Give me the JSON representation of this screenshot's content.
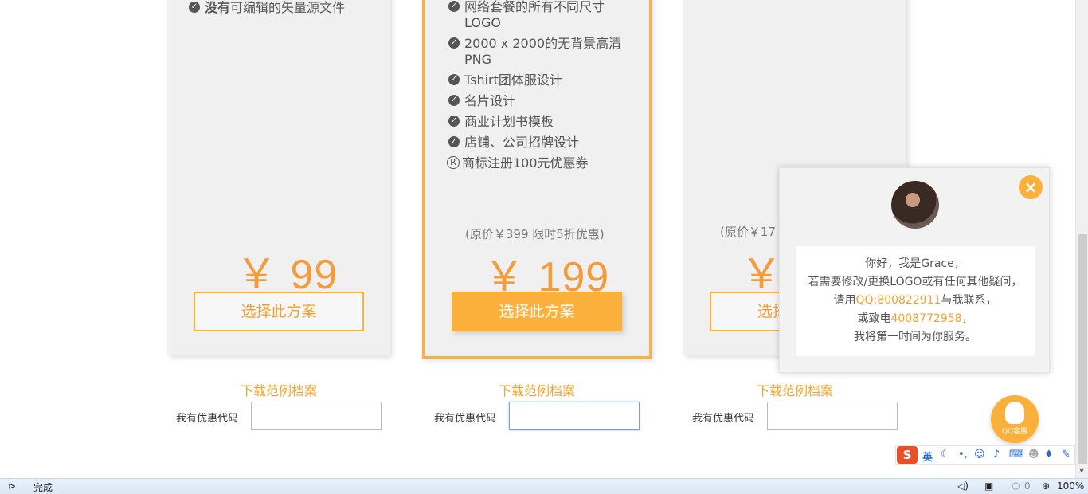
{
  "plans": [
    {
      "features": [
        {
          "bold": "没有",
          "text": "可编辑的矢量源文件"
        }
      ],
      "original_price": "",
      "price": "￥ 99",
      "button": "选择此方案",
      "download": "下载范例档案",
      "coupon_label": "我有优惠代码",
      "coupon_value": ""
    },
    {
      "features": [
        {
          "text": "网络套餐的所有不同尺寸",
          "text2": "LOGO"
        },
        {
          "text": "2000 x 2000的无背景高清",
          "text2": "PNG"
        },
        {
          "text": "Tshirt团体服设计"
        },
        {
          "text": "名片设计"
        },
        {
          "text": "商业计划书模板"
        },
        {
          "text": "店铺、公司招牌设计"
        },
        {
          "text": "商标注册100元优惠券"
        }
      ],
      "original_price": "(原价￥399 限时5折优惠)",
      "price": "￥ 199",
      "button": "选择此方案",
      "download": "下载范例档案",
      "coupon_label": "我有优惠代码",
      "coupon_value": ""
    },
    {
      "features": [],
      "original_price": "(原价￥17",
      "price": "￥",
      "button": "选择",
      "download": "下载范例档案",
      "coupon_label": "我有优惠代码",
      "coupon_value": ""
    }
  ],
  "chat_popup": {
    "line1": "你好，我是Grace，",
    "line2": "若需要修改/更换LOGO或有任何其他疑问，",
    "line3_pre": "请用",
    "line3_hl": "QQ:800822911",
    "line3_post": "与我联系，",
    "line4_pre": "或致电",
    "line4_hl": "4008772958",
    "line4_post": "，",
    "line5": "我将第一时间为你服务。",
    "close_glyph": "×"
  },
  "qq_button": {
    "label": "QQ客服"
  },
  "ime": {
    "logo": "S",
    "mode": "英",
    "icons": [
      "moon-icon",
      "punctuation-icon",
      "emoji-icon",
      "mic-icon",
      "keyboard-icon",
      "user-icon",
      "shirt-icon",
      "wrench-icon"
    ]
  },
  "statusbar": {
    "status": "完成",
    "zoom": "100%",
    "counter": "0"
  },
  "colors": {
    "accent": "#fbb03b",
    "price": "#f39c3c",
    "card_bg": "#f0f0f0"
  }
}
